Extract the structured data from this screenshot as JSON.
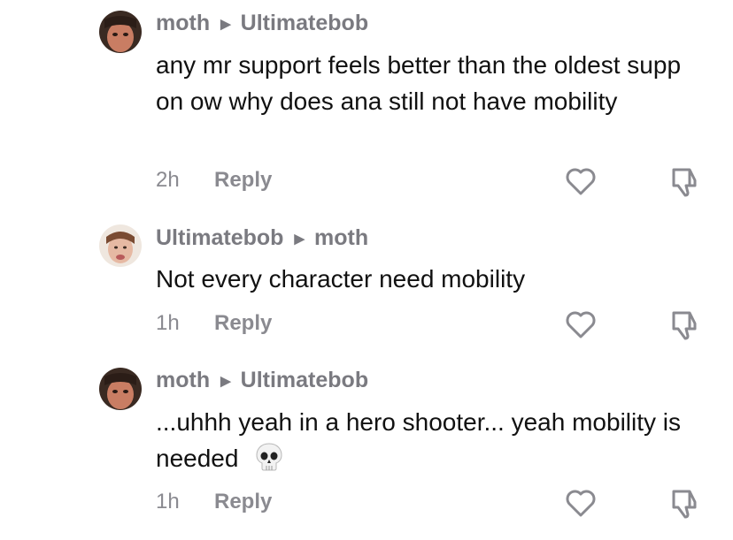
{
  "comments": [
    {
      "author": "moth",
      "reply_to": "Ultimatebob",
      "text": "any mr support feels better than the oldest supp on ow why does ana still not have mobility",
      "time": "2h",
      "reply_label": "Reply",
      "avatar_icon": "user-avatar-photo"
    },
    {
      "author": "Ultimatebob",
      "reply_to": "moth",
      "text": "Not every character need mobility",
      "time": "1h",
      "reply_label": "Reply",
      "avatar_icon": "user-avatar-photo"
    },
    {
      "author": "moth",
      "reply_to": "Ultimatebob",
      "text": "...uhhh yeah in a hero shooter... yeah mobility is needed",
      "emoji": "skull-emoji",
      "time": "1h",
      "reply_label": "Reply",
      "avatar_icon": "user-avatar-photo"
    }
  ],
  "icons": {
    "reply_arrow": "triangle-right-icon",
    "like": "heart-outline-icon",
    "dislike": "thumbs-down-outline-icon"
  },
  "colors": {
    "secondary_text": "#7a7a80",
    "primary_text": "#111111",
    "background": "#ffffff"
  }
}
